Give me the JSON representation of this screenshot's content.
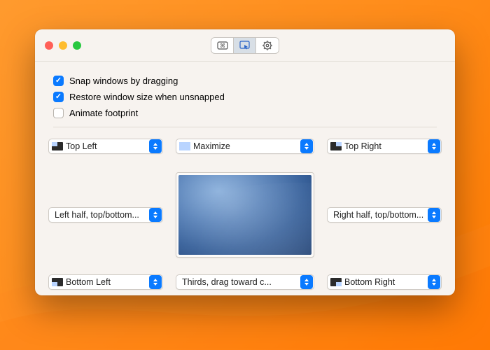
{
  "checkboxes": {
    "snap": {
      "label": "Snap windows by dragging",
      "checked": true
    },
    "restore": {
      "label": "Restore window size when unsnapped",
      "checked": true
    },
    "animate": {
      "label": "Animate footprint",
      "checked": false
    }
  },
  "dropdowns": {
    "top_left": "Top Left",
    "top_center": "Maximize",
    "top_right": "Top Right",
    "mid_left": "Left half, top/bottom...",
    "mid_right": "Right half, top/bottom...",
    "bottom_left": "Bottom Left",
    "bottom_center": "Thirds, drag toward c...",
    "bottom_right": "Bottom Right"
  },
  "toolbar": {
    "tabs": [
      "keyboard",
      "snap",
      "settings"
    ],
    "active": "snap"
  }
}
